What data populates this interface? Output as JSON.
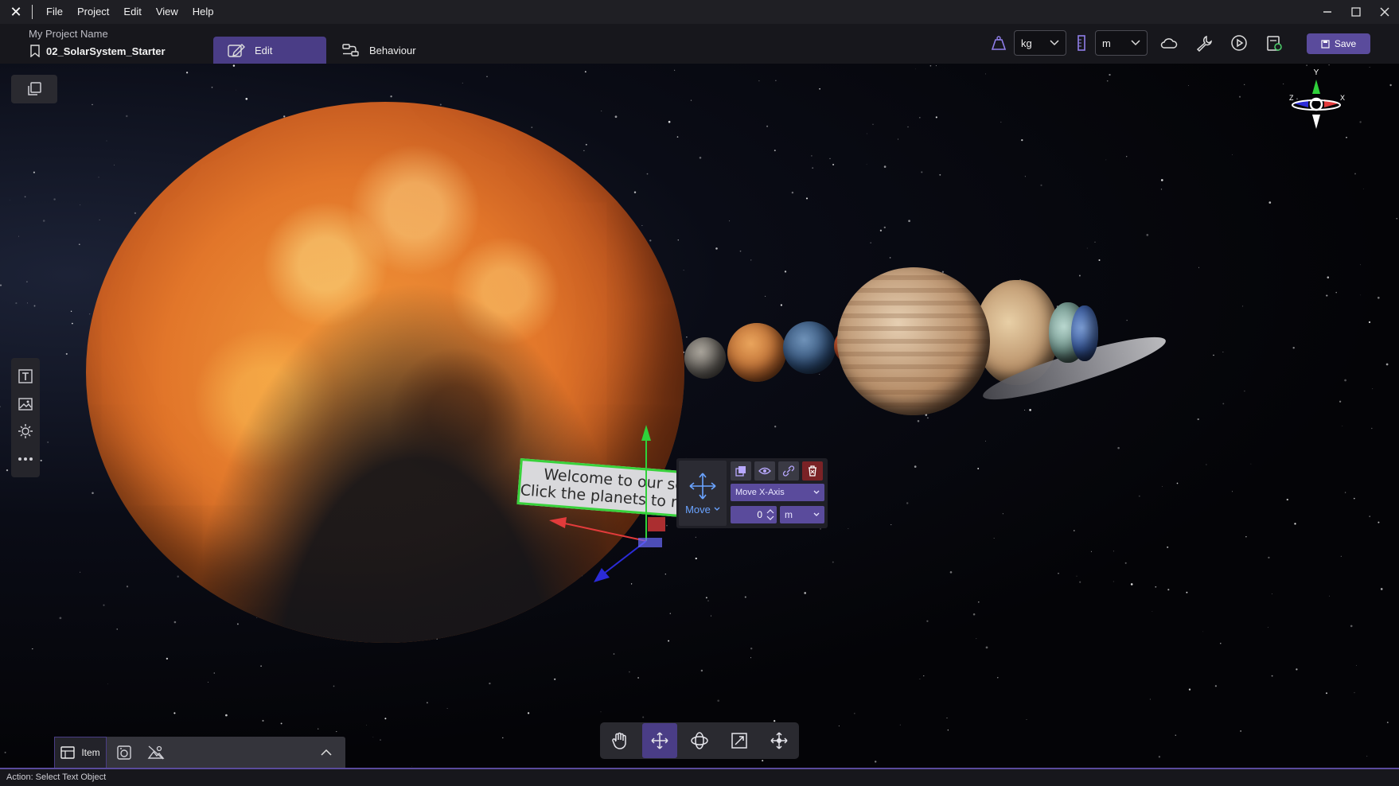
{
  "menu": {
    "items": [
      "File",
      "Project",
      "Edit",
      "View",
      "Help"
    ]
  },
  "header": {
    "project_name": "My Project Name",
    "scene_name": "02_SolarSystem_Starter",
    "tabs": [
      {
        "label": "Edit",
        "active": true
      },
      {
        "label": "Behaviour",
        "active": false
      }
    ],
    "mass_unit": "kg",
    "length_unit": "m",
    "save_label": "Save"
  },
  "viewport": {
    "welcome_text_line1": "Welcome to our solar system!",
    "welcome_text_line2": "Click the planets to reach the planet!",
    "axis_gizmo": {
      "y": "Y",
      "x": "X",
      "z": "Z"
    }
  },
  "move_panel": {
    "mode_label": "Move",
    "axis_option": "Move X-Axis",
    "value": "0",
    "unit": "m"
  },
  "bottom_panel": {
    "item_tab_label": "Item"
  },
  "status": {
    "text": "Action: Select Text Object"
  },
  "colors": {
    "accent": "#5a4b9c",
    "selection": "#38d23b",
    "x_axis": "#e23b3b",
    "y_axis": "#2fd13a",
    "z_axis": "#2b2bd8"
  },
  "icons": {
    "app": "logo-icon",
    "toolbar": [
      "mass-icon",
      "length-icon",
      "cloud-icon",
      "wrench-icon",
      "play-icon",
      "export-icon"
    ],
    "transform_tools": [
      "hand-icon",
      "move-icon",
      "rotate-icon",
      "scale-icon",
      "pivot-icon"
    ]
  }
}
